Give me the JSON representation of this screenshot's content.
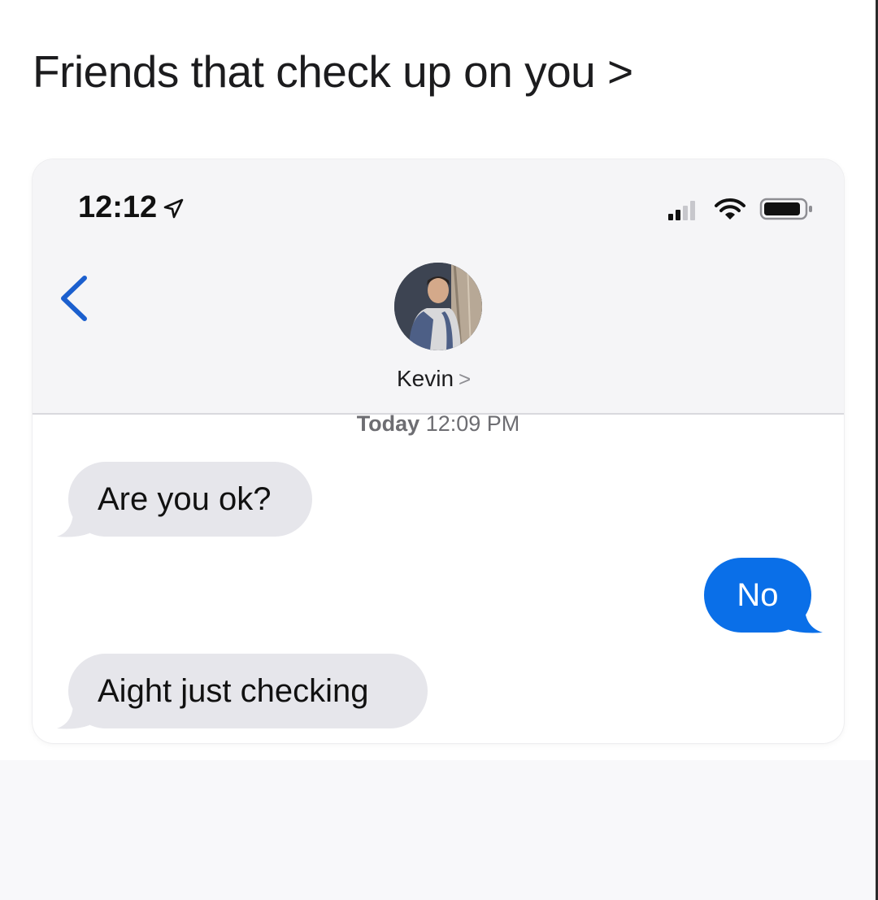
{
  "post": {
    "caption": "Friends that check up on you >"
  },
  "status_bar": {
    "time": "12:12",
    "icons": [
      "location-arrow-icon",
      "cellular-signal-icon",
      "wifi-icon",
      "battery-icon"
    ]
  },
  "conversation": {
    "back_icon": "chevron-left-icon",
    "contact_name": "Kevin",
    "contact_chevron": ">",
    "timestamp_day": "Today",
    "timestamp_time": "12:09 PM",
    "messages": [
      {
        "direction": "incoming",
        "text": "Are you ok?"
      },
      {
        "direction": "outgoing",
        "text": "No"
      },
      {
        "direction": "incoming",
        "text": "Aight just checking"
      }
    ]
  },
  "colors": {
    "outgoing_bubble": "#0a6fe8",
    "incoming_bubble": "#e6e6eb",
    "back_chevron": "#1b5fce",
    "header_background": "#f5f5f7"
  }
}
